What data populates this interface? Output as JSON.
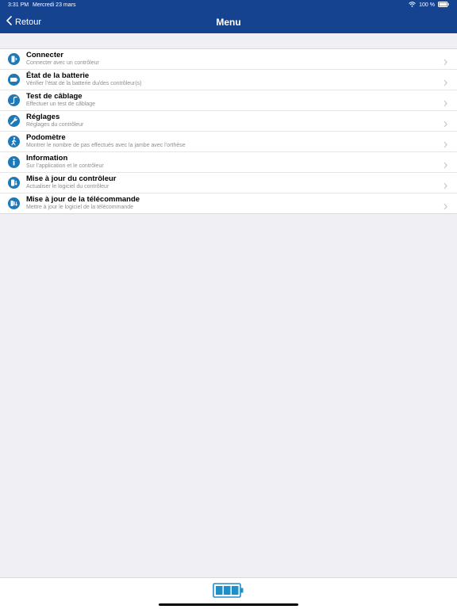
{
  "status_bar": {
    "time": "3:31 PM",
    "date": "Mercredi 23 mars",
    "battery_percent": "100 %"
  },
  "nav": {
    "back_label": "Retour",
    "title": "Menu"
  },
  "menu": {
    "items": [
      {
        "title": "Connecter",
        "subtitle": "Connecter avec un contrôleur",
        "icon": "controller-connect-icon"
      },
      {
        "title": "État de la batterie",
        "subtitle": "Vérifier l’état de la batterie du/des contrôleur(s)",
        "icon": "battery-icon"
      },
      {
        "title": "Test de câblage",
        "subtitle": "Effectuer un test de câblage",
        "icon": "cable-icon"
      },
      {
        "title": "Réglages",
        "subtitle": "Réglages du contrôleur",
        "icon": "wrench-icon"
      },
      {
        "title": "Podomètre",
        "subtitle": "Montrer le nombre de pas effectués avec la jambe avec l’orthèse",
        "icon": "walking-icon"
      },
      {
        "title": "Information",
        "subtitle": "Sur l’application et le contrôleur",
        "icon": "info-icon"
      },
      {
        "title": "Mise à jour du contrôleur",
        "subtitle": "Actualiser le logiciel du contrôleur",
        "icon": "controller-update-icon"
      },
      {
        "title": "Mise à jour de la télécommande",
        "subtitle": "Mettre à jour le logiciel de la télécommande",
        "icon": "remote-update-icon"
      }
    ]
  },
  "footer": {
    "battery_icon": "battery-full-icon"
  },
  "colors": {
    "header": "#16438f",
    "icon_circle": "#1e79b8",
    "footer_battery": "#1e90c8",
    "background": "#efeff4"
  }
}
